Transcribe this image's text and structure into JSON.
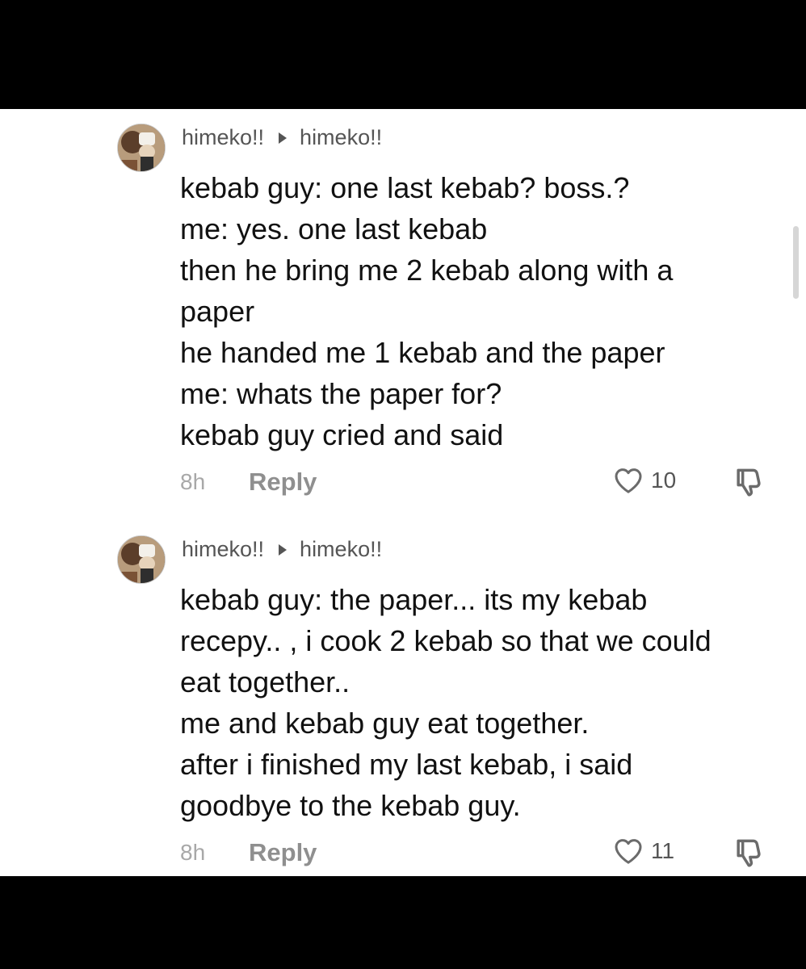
{
  "comments": [
    {
      "username": "himeko!!",
      "reply_to": "himeko!!",
      "lines": [
        "kebab guy: one last kebab? boss.?",
        "me: yes. one last kebab",
        "then he bring me 2 kebab along with a",
        "paper",
        "he handed me 1 kebab and the paper",
        "me: whats the paper for?",
        "kebab guy cried and said"
      ],
      "time": "8h",
      "reply_label": "Reply",
      "likes": "10"
    },
    {
      "username": "himeko!!",
      "reply_to": "himeko!!",
      "lines": [
        "kebab guy: the paper... its my kebab",
        "recepy.. , i cook 2 kebab so that we could",
        "eat together..",
        "me and kebab guy eat together.",
        "after i finished my last kebab, i said",
        "goodbye to the kebab guy."
      ],
      "time": "8h",
      "reply_label": "Reply",
      "likes": "11"
    }
  ],
  "icons": {
    "like": "heart-icon",
    "dislike": "thumbs-down-icon",
    "reply_arrow": "caret-right-icon"
  },
  "colors": {
    "background": "#ffffff",
    "text": "#111111",
    "secondary": "#8f8f8f",
    "frame": "#000000"
  }
}
